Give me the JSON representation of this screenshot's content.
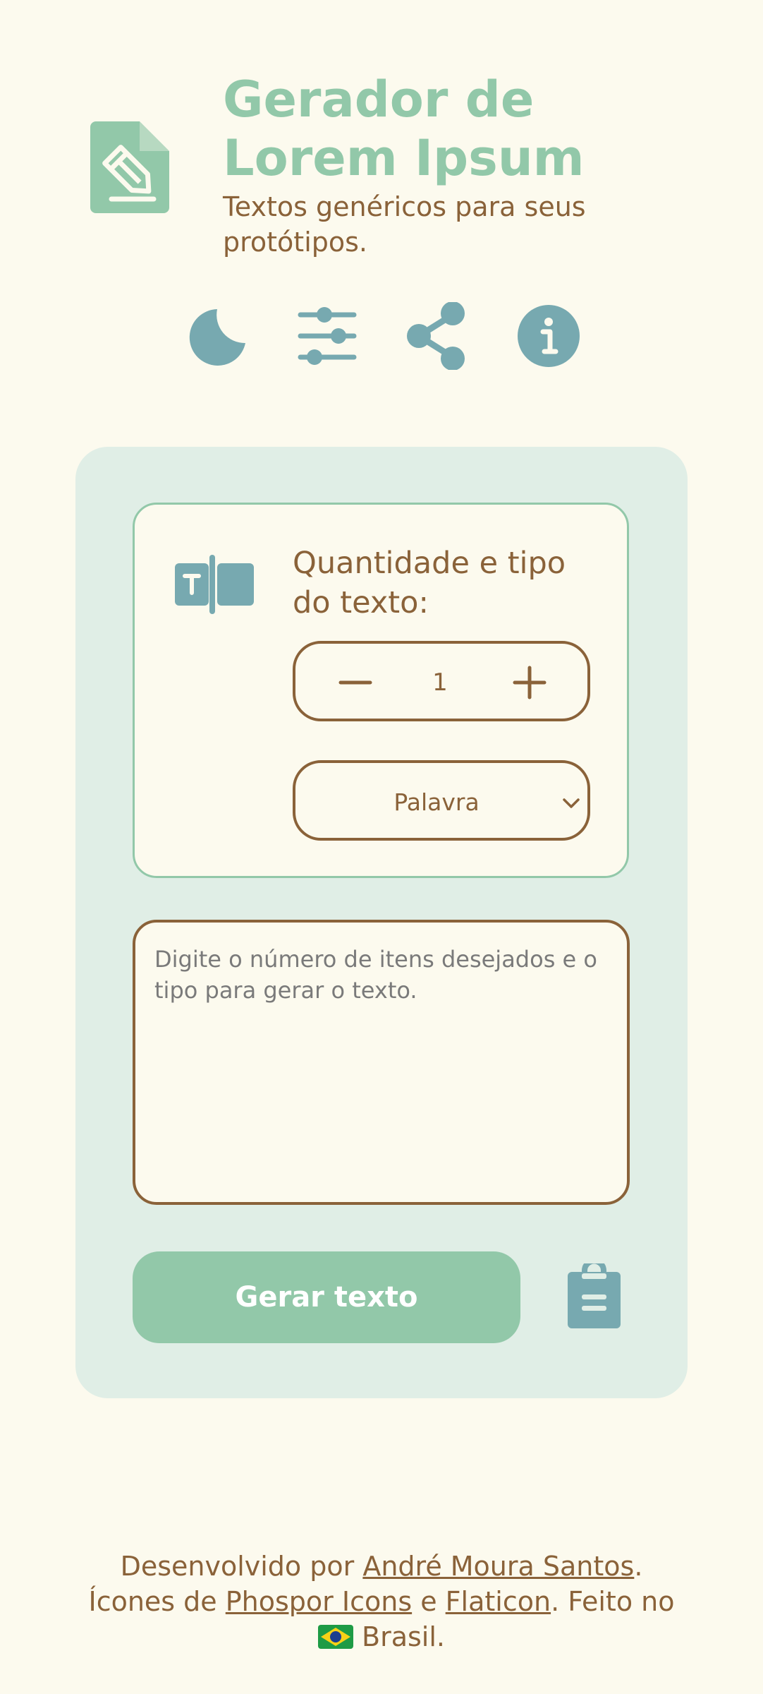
{
  "header": {
    "title": "Gerador de Lorem Ipsum",
    "subtitle": "Textos genéricos para seus protótipos."
  },
  "toolbar": {
    "icons": [
      "moon-icon",
      "sliders-icon",
      "share-icon",
      "info-icon"
    ]
  },
  "settings": {
    "label": "Quantidade e tipo do texto:",
    "quantity": "1",
    "type_selected": "Palavra"
  },
  "output": {
    "placeholder": "Digite o número de itens desejados e o tipo para gerar o texto."
  },
  "actions": {
    "generate_label": "Gerar texto"
  },
  "footer": {
    "developed_by": "Desenvolvido por ",
    "author": "André Moura Santos",
    "period1": ".",
    "icons_from": "Ícones de ",
    "phosphor": "Phospor Icons",
    "and": " e ",
    "flaticon": "Flaticon",
    "made_in": ". Feito no",
    "country": "Brasil."
  },
  "colors": {
    "background": "#fcfaee",
    "green": "#92c8a9",
    "teal": "#77a9b0",
    "brown": "#8a6239",
    "card": "#e0eee6"
  }
}
